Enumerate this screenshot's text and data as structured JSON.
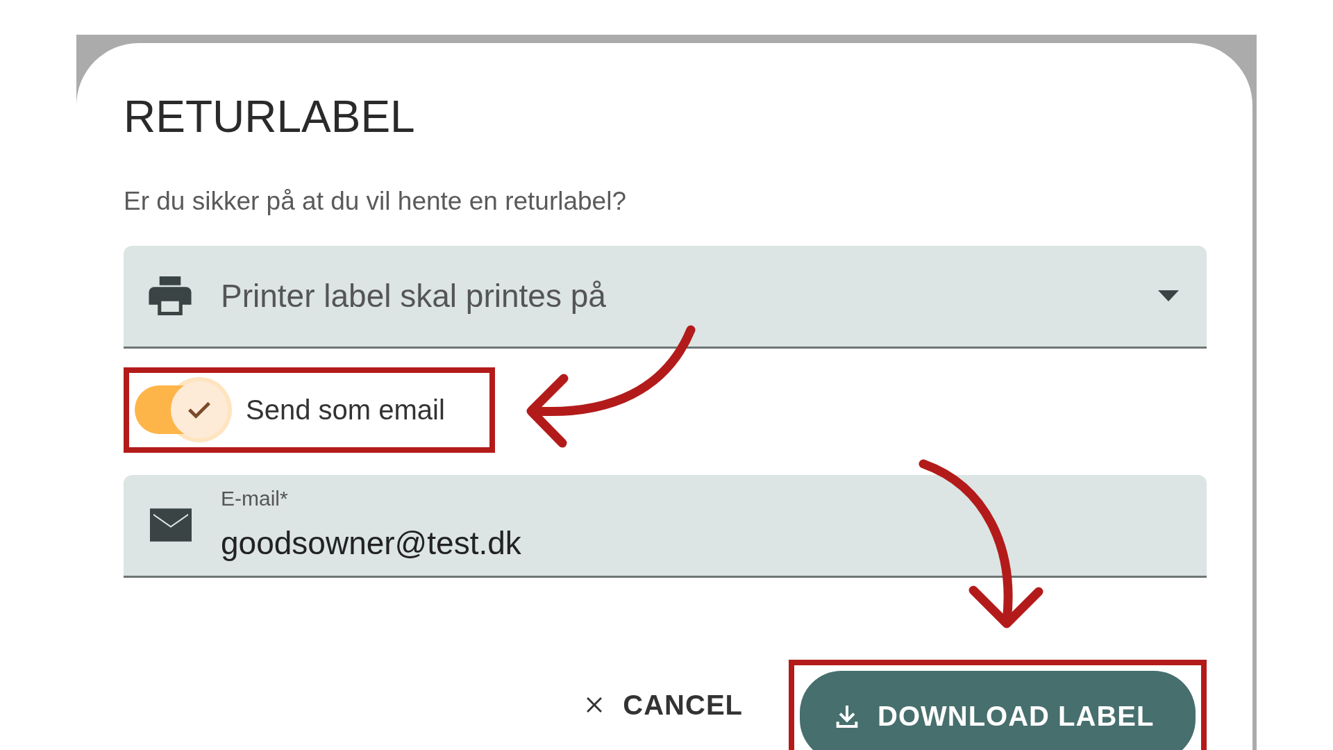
{
  "dialog": {
    "title": "RETURLABEL",
    "message": "Er du sikker på at du vil hente en returlabel?",
    "printer_select": {
      "placeholder": "Printer label skal printes på"
    },
    "send_as_email": {
      "label": "Send som email",
      "on": true
    },
    "email_field": {
      "label": "E-mail*",
      "value": "goodsowner@test.dk"
    },
    "buttons": [
      {
        "kind": "text",
        "label": "CANCEL"
      },
      {
        "kind": "contained",
        "label": "DOWNLOAD LABEL"
      }
    ]
  }
}
